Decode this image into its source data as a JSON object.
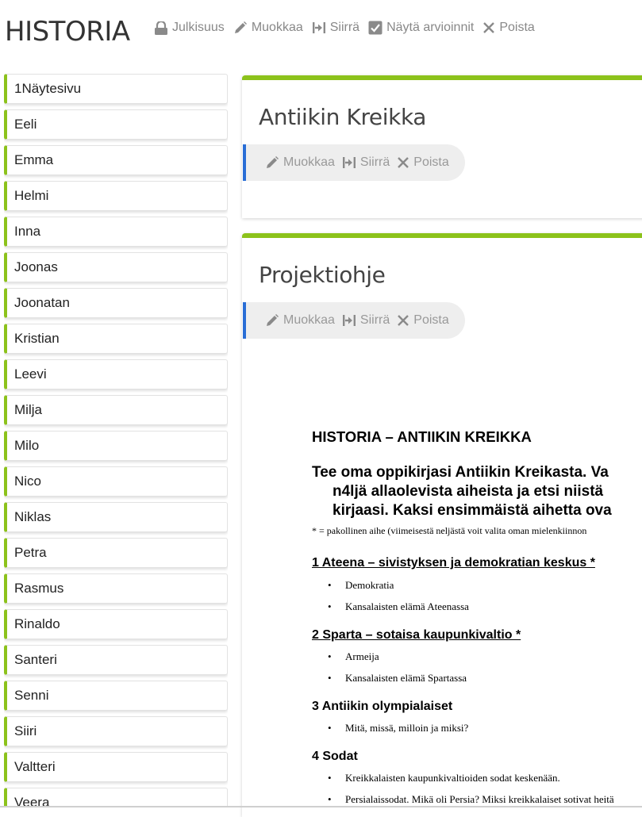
{
  "header": {
    "title": "HISTORIA",
    "actions": [
      {
        "label": "Julkisuus",
        "icon": "lock-icon"
      },
      {
        "label": "Muokkaa",
        "icon": "pencil-icon"
      },
      {
        "label": "Siirrä",
        "icon": "move-icon"
      },
      {
        "label": "Näytä arvioinnit",
        "icon": "checkbox-icon"
      },
      {
        "label": "Poista",
        "icon": "close-icon"
      }
    ]
  },
  "sidebar": {
    "students": [
      "1Näytesivu",
      "Eeli",
      "Emma",
      "Helmi",
      "Inna",
      "Joonas",
      "Joonatan",
      "Kristian",
      "Leevi",
      "Milja",
      "Milo",
      "Nico",
      "Niklas",
      "Petra",
      "Rasmus",
      "Rinaldo",
      "Santeri",
      "Senni",
      "Siiri",
      "Valtteri",
      "Veera"
    ]
  },
  "cards": [
    {
      "title": "Antiikin Kreikka",
      "actions": {
        "edit": "Muokkaa",
        "move": "Siirrä",
        "delete": "Poista"
      }
    },
    {
      "title": "Projektiohje",
      "actions": {
        "edit": "Muokkaa",
        "move": "Siirrä",
        "delete": "Poista"
      },
      "document": {
        "heading": "HISTORIA – ANTIIKIN KREIKKA",
        "intro_lines": [
          "Tee oma oppikirjasi Antiikin Kreikasta. Va",
          "n4ljä allaolevista aiheista ja etsi niistä",
          "kirjaasi. Kaksi ensimmäistä aihetta ova"
        ],
        "note": "* = pakollinen aihe (viimeisestä neljästä voit valita oman mielenkiinnon",
        "sections": [
          {
            "title": "1 Ateena – sivistyksen ja demokratian keskus *",
            "underline": true,
            "items": [
              "Demokratia",
              "Kansalaisten elämä Ateenassa"
            ]
          },
          {
            "title": "2 Sparta – sotaisa kaupunkivaltio *",
            "underline": true,
            "items": [
              "Armeija",
              "Kansalaisten elämä Spartassa"
            ]
          },
          {
            "title": "3 Antiikin olympialaiset",
            "underline": false,
            "items": [
              "Mitä, missä, milloin ja miksi?"
            ]
          },
          {
            "title": "4 Sodat",
            "underline": false,
            "items": [
              "Kreikkalaisten kaupunkivaltioiden sodat keskenään.",
              "Persialaissodat. Mikä oli Persia? Miksi kreikkalaiset sotivat heitä"
            ]
          }
        ]
      }
    }
  ],
  "colors": {
    "accent_green": "#8cc21b",
    "accent_blue": "#2a6ed6",
    "muted_text": "#888888"
  }
}
